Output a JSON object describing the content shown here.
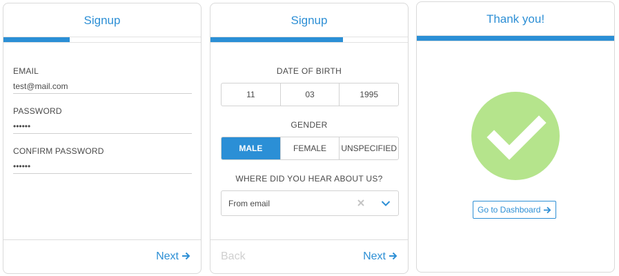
{
  "cards": [
    {
      "title": "Signup",
      "progress": 0.33,
      "fields": [
        {
          "label": "EMAIL",
          "value": "test@mail.com"
        },
        {
          "label": "PASSWORD",
          "value": "••••••"
        },
        {
          "label": "CONFIRM PASSWORD",
          "value": "••••••"
        }
      ],
      "next_label": "Next"
    },
    {
      "title": "Signup",
      "progress": 0.66,
      "dob": {
        "label": "DATE OF BIRTH",
        "day": "11",
        "month": "03",
        "year": "1995"
      },
      "gender": {
        "label": "GENDER",
        "options": [
          "MALE",
          "FEMALE",
          "UNSPECIFIED"
        ],
        "selected": "MALE"
      },
      "source": {
        "label": "WHERE DID YOU HEAR ABOUT US?",
        "value": "From email"
      },
      "back_label": "Back",
      "next_label": "Next"
    },
    {
      "title": "Thank you!",
      "progress": 1.0,
      "button_label": "Go to Dashboard"
    }
  ],
  "colors": {
    "accent": "#2b8fd6",
    "success": "#b5e48c"
  },
  "icons": [
    "arrow-right-icon",
    "clear-icon",
    "chevron-down-icon",
    "checkmark-icon"
  ]
}
